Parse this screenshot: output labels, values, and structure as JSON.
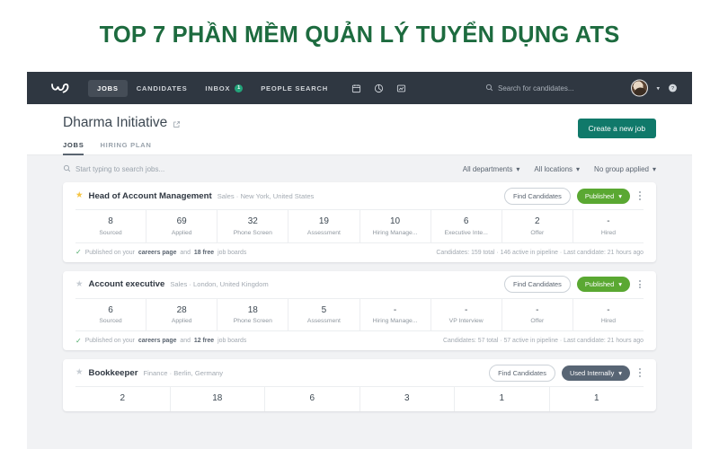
{
  "banner": {
    "title": "TOP 7 PHẦN MỀM QUẢN LÝ TUYỂN DỤNG ATS",
    "color": "#1d6b3f"
  },
  "navbar": {
    "logo_icon": "workable-logo-icon",
    "items": [
      {
        "label": "JOBS",
        "active": true,
        "badge": ""
      },
      {
        "label": "CANDIDATES",
        "active": false,
        "badge": ""
      },
      {
        "label": "INBOX",
        "active": false,
        "badge": "1"
      },
      {
        "label": "PEOPLE SEARCH",
        "active": false,
        "badge": ""
      }
    ],
    "icons": [
      "calendar-icon",
      "analytics-icon",
      "reports-icon"
    ],
    "search_placeholder": "Search for candidates...",
    "search_icon": "search-icon",
    "avatar": "user-avatar",
    "avatar_chevron": "chevron-down-icon",
    "help_icon": "help-icon",
    "badge_color": "#23a47a",
    "background": "#2f3741"
  },
  "subheader": {
    "org_title": "Dharma Initiative",
    "external_link_icon": "external-link-icon",
    "tabs": [
      {
        "label": "JOBS",
        "active": true
      },
      {
        "label": "HIRING PLAN",
        "active": false
      }
    ],
    "create_button": "Create a new job",
    "create_button_color": "#10796a"
  },
  "filterbar": {
    "search_placeholder": "Start typing to search jobs...",
    "search_icon": "search-icon",
    "filters": [
      {
        "label": "All departments"
      },
      {
        "label": "All locations"
      },
      {
        "label": "No group applied"
      }
    ]
  },
  "jobs": [
    {
      "starred": true,
      "title": "Head of Account Management",
      "meta": "Sales · New York, United States",
      "find_candidates": "Find Candidates",
      "status": "Published",
      "status_type": "published",
      "stats": [
        {
          "value": "8",
          "label": "Sourced"
        },
        {
          "value": "69",
          "label": "Applied"
        },
        {
          "value": "32",
          "label": "Phone Screen"
        },
        {
          "value": "19",
          "label": "Assessment"
        },
        {
          "value": "10",
          "label": "Hiring Manage..."
        },
        {
          "value": "6",
          "label": "Executive Inte..."
        },
        {
          "value": "2",
          "label": "Offer"
        },
        {
          "value": "-",
          "label": "Hired"
        }
      ],
      "footer_prefix": "Published on your",
      "footer_link": "careers page",
      "footer_mid": "and",
      "footer_bold": "18 free",
      "footer_suffix": "job boards",
      "footer_right": "Candidates: 159 total · 146 active in pipeline · Last candidate: 21 hours ago"
    },
    {
      "starred": false,
      "title": "Account executive",
      "meta": "Sales · London, United Kingdom",
      "find_candidates": "Find Candidates",
      "status": "Published",
      "status_type": "published",
      "stats": [
        {
          "value": "6",
          "label": "Sourced"
        },
        {
          "value": "28",
          "label": "Applied"
        },
        {
          "value": "18",
          "label": "Phone Screen"
        },
        {
          "value": "5",
          "label": "Assessment"
        },
        {
          "value": "-",
          "label": "Hiring Manage..."
        },
        {
          "value": "-",
          "label": "VP Interview"
        },
        {
          "value": "-",
          "label": "Offer"
        },
        {
          "value": "-",
          "label": "Hired"
        }
      ],
      "footer_prefix": "Published on your",
      "footer_link": "careers page",
      "footer_mid": "and",
      "footer_bold": "12 free",
      "footer_suffix": "job boards",
      "footer_right": "Candidates: 57 total · 57 active in pipeline · Last candidate: 21 hours ago"
    },
    {
      "starred": false,
      "title": "Bookkeeper",
      "meta": "Finance · Berlin, Germany",
      "find_candidates": "Find Candidates",
      "status": "Used Internally",
      "status_type": "internal",
      "stats": [
        {
          "value": "2",
          "label": ""
        },
        {
          "value": "18",
          "label": ""
        },
        {
          "value": "6",
          "label": ""
        },
        {
          "value": "3",
          "label": ""
        },
        {
          "value": "1",
          "label": ""
        },
        {
          "value": "1",
          "label": ""
        }
      ],
      "footer_prefix": "",
      "footer_link": "",
      "footer_mid": "",
      "footer_bold": "",
      "footer_suffix": "",
      "footer_right": ""
    }
  ]
}
